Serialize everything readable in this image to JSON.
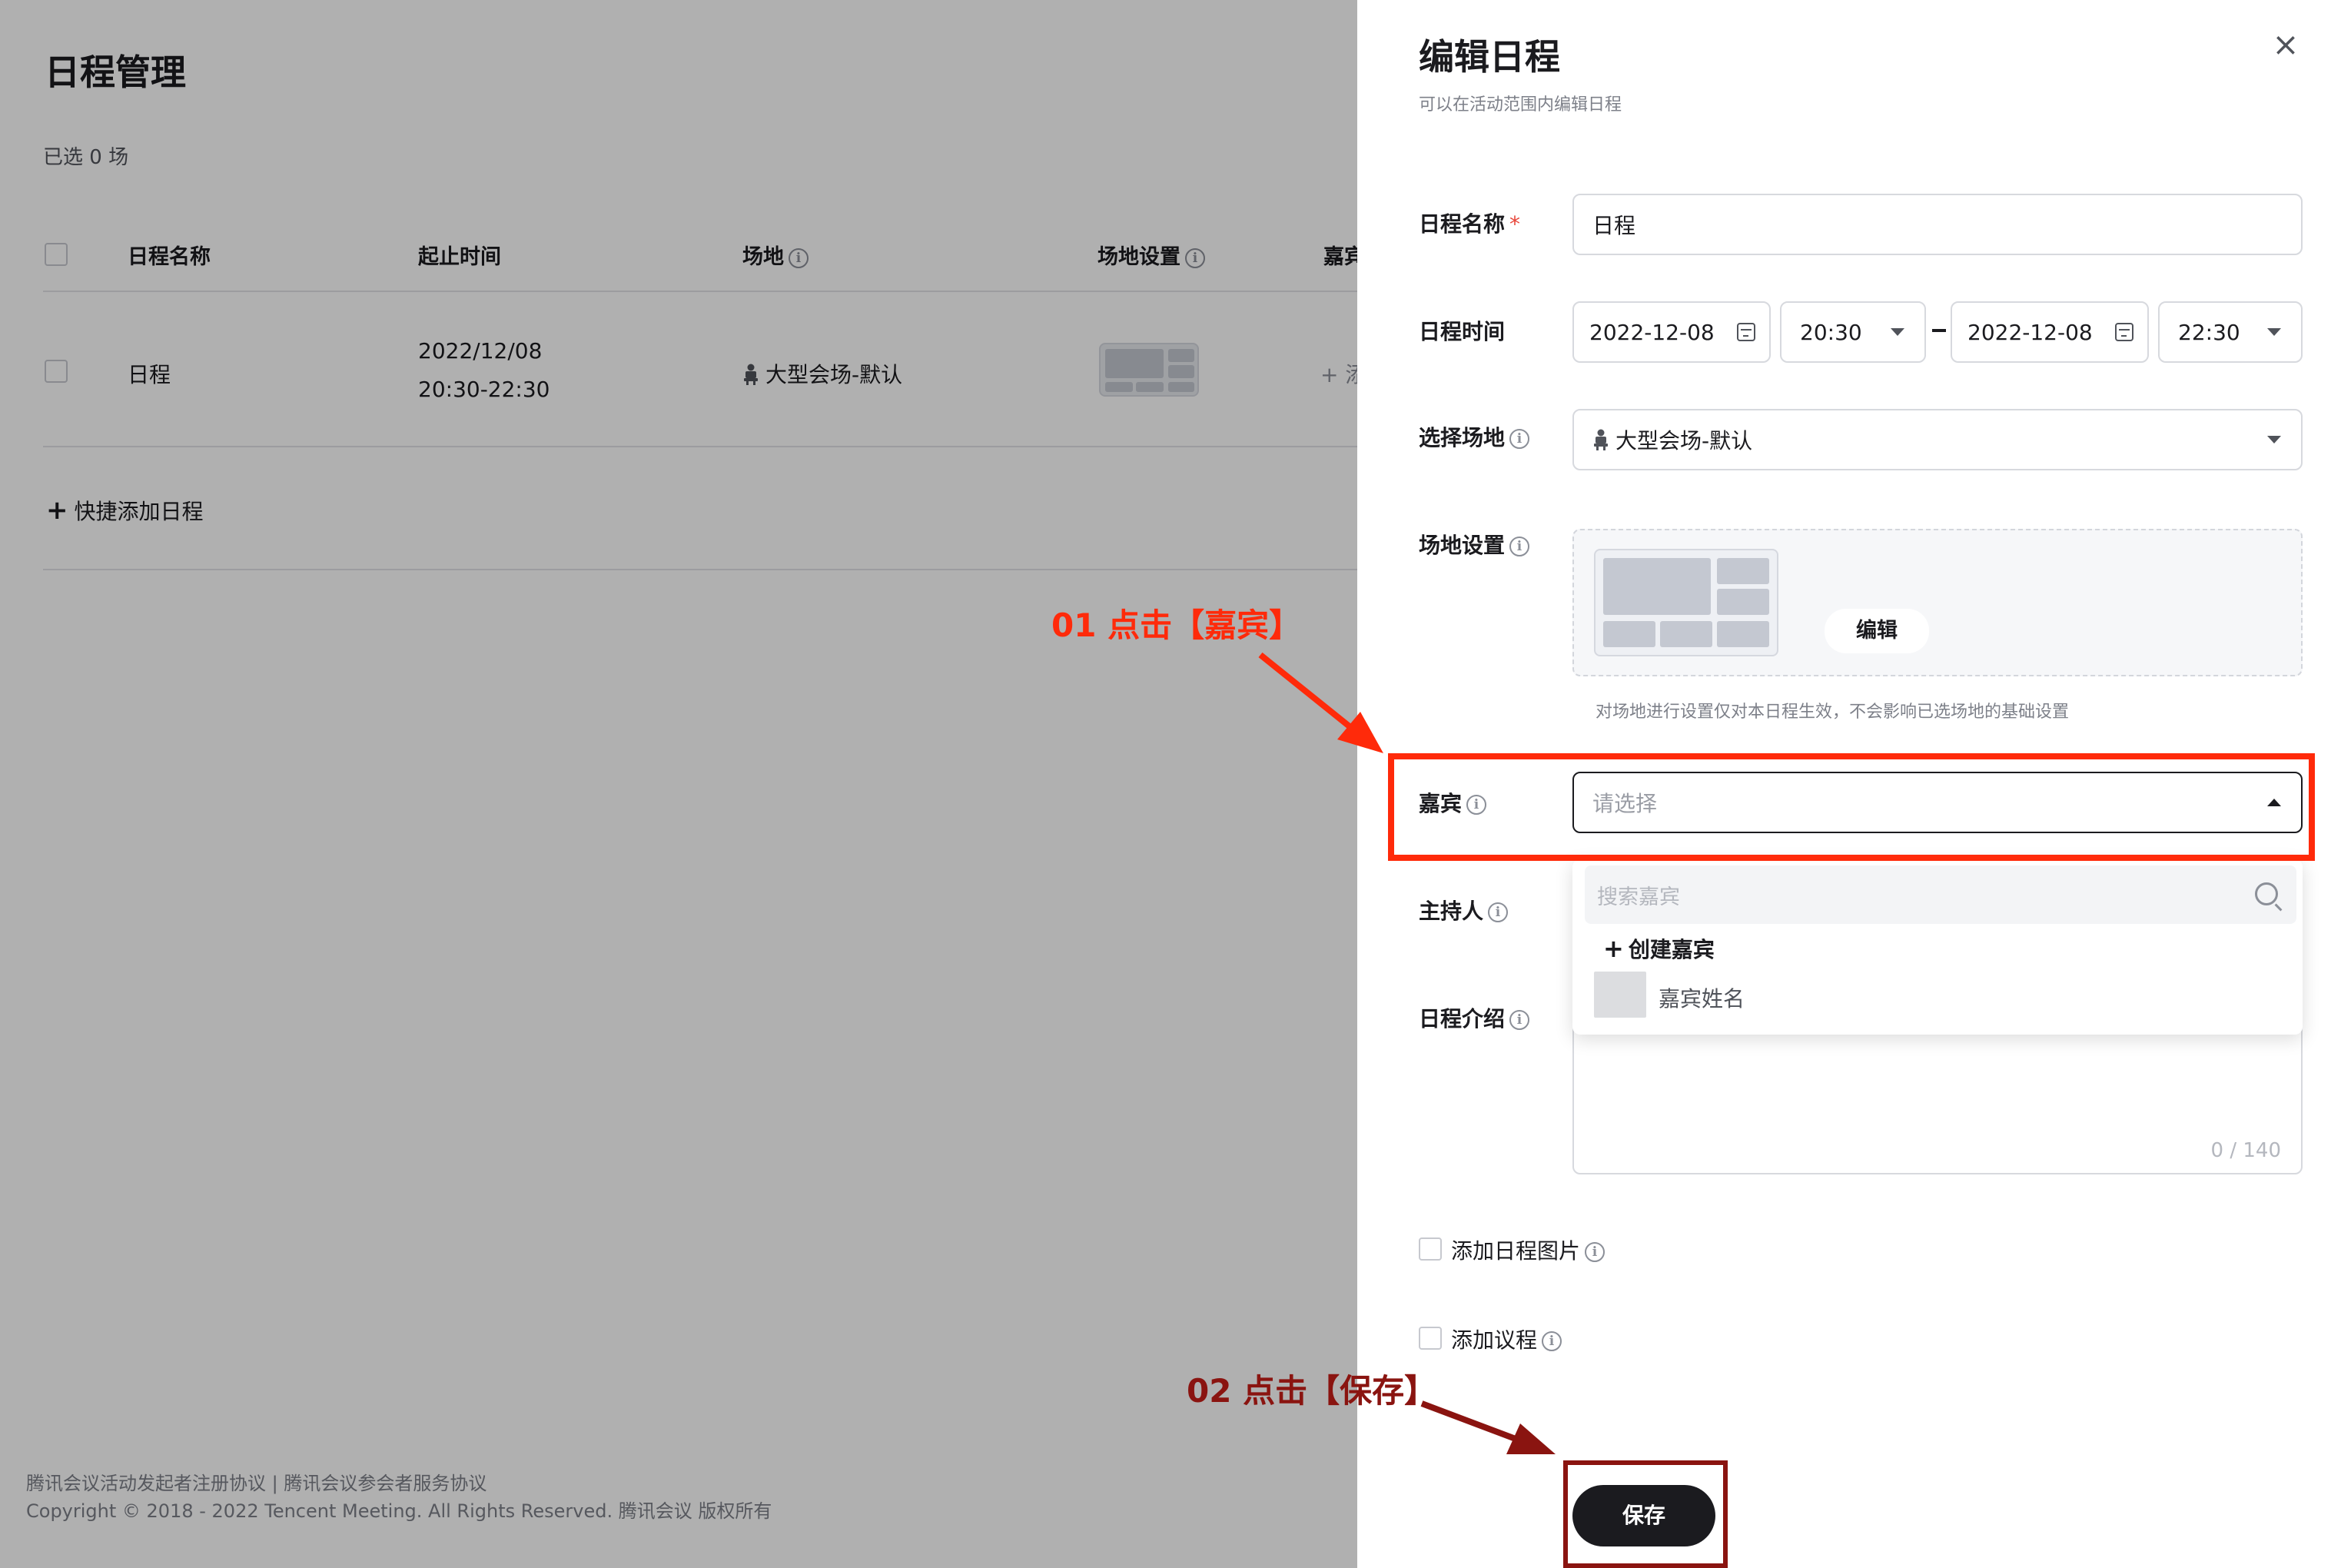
{
  "page": {
    "title": "日程管理",
    "selected_count": "已选 0 场",
    "table": {
      "headers": [
        "日程名称",
        "起止时间",
        "场地",
        "场地设置",
        "嘉宾"
      ],
      "rows": [
        {
          "name": "日程",
          "date": "2022/12/08",
          "time": "20:30-22:30",
          "venue": "大型会场-默认",
          "guest_action": "+ 添"
        }
      ]
    },
    "quick_add": "快捷添加日程",
    "footer": {
      "links": "腾讯会议活动发起者注册协议 | 腾讯会议参会者服务协议",
      "copyright": "Copyright © 2018 - 2022 Tencent Meeting. All Rights Reserved. 腾讯会议 版权所有"
    }
  },
  "drawer": {
    "title": "编辑日程",
    "subtitle": "可以在活动范围内编辑日程",
    "close_icon": "close-icon",
    "fields": {
      "name": {
        "label": "日程名称",
        "required_mark": "*",
        "value": "日程"
      },
      "time": {
        "label": "日程时间",
        "start_date": "2022-12-08",
        "start_time": "20:30",
        "end_date": "2022-12-08",
        "end_time": "22:30"
      },
      "venue": {
        "label": "选择场地",
        "value": "大型会场-默认"
      },
      "venue_settings": {
        "label": "场地设置",
        "edit_label": "编辑",
        "hint": "对场地进行设置仅对本日程生效，不会影响已选场地的基础设置"
      },
      "guest": {
        "label": "嘉宾",
        "placeholder": "请选择",
        "search_placeholder": "搜索嘉宾",
        "create_label": "创建嘉宾",
        "options": [
          "嘉宾姓名"
        ]
      },
      "host": {
        "label": "主持人"
      },
      "intro": {
        "label": "日程介绍",
        "counter": "0 / 140"
      },
      "add_image": {
        "label": "添加日程图片"
      },
      "add_agenda": {
        "label": "添加议程"
      }
    },
    "save_label": "保存"
  },
  "annotations": {
    "step1": "01 点击【嘉宾】",
    "step2": "02 点击【保存】",
    "colors": {
      "step1": "#ff2a0a",
      "step2": "#8a1410"
    }
  },
  "colors": {
    "primary_button": "#1b1b1f",
    "required": "#e8463a",
    "overlay": "rgba(0,0,0,0.31)"
  }
}
